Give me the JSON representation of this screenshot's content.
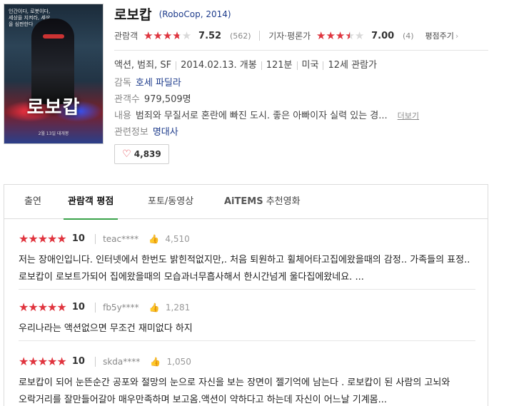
{
  "movie": {
    "poster_title": "로보캅",
    "poster_tagline": "인간이다, 로봇이다, 세상을 지켜라, 세상을 심판한다",
    "poster_release": "2월 13일 대개봉",
    "title_ko": "로보캅",
    "title_en": "(RoboCop, 2014)",
    "audience_label": "관람객",
    "audience_stars_fraction": 0.75,
    "audience_score": "7.52",
    "audience_count": "(562)",
    "critic_label": "기자·평론가",
    "critic_stars_fraction": 0.7,
    "critic_score": "7.00",
    "critic_count": "(4)",
    "rate_label": "평점주기",
    "genre": "액션, 범죄, SF",
    "release": "2014.02.13. 개봉",
    "runtime": "121분",
    "country": "미국",
    "age": "12세 관람가",
    "director_label": "감독",
    "director": "호세 파딜라",
    "audience_total_label": "관객수",
    "audience_total": "979,509명",
    "plot_label": "내용",
    "plot": "범죄와 무질서로 혼란에 빠진 도시. 좋은 아빠이자 실력 있는 경...",
    "more_label": "더보기",
    "related_label": "관련정보",
    "related_link": "명대사",
    "likes": "4,839"
  },
  "tabs": [
    {
      "label": "출연"
    },
    {
      "label": "관람객 평점"
    },
    {
      "label": "포토/동영상"
    },
    {
      "label": "AiTEMS"
    },
    {
      "label": "추천영화"
    }
  ],
  "reviews": [
    {
      "score": "10",
      "user": "teac****",
      "likes": "4,510",
      "text": "저는 장애인입니다. 인터넷에서 한번도 밝힌적없지만,. 처음 퇴원하고 휠체어타고집에왔을때의 감정.. 가족들의 표정.. 로보캅이 로보트가되어 집에왔을때의 모습과너무흡사해서 한시간넘게 울다집에왔네요. ..."
    },
    {
      "score": "10",
      "user": "fb5y****",
      "likes": "1,281",
      "text": "우리나라는 액션없으면 무조건 재미없다 하지"
    },
    {
      "score": "10",
      "user": "skda****",
      "likes": "1,050",
      "text": "로보캅이 되어 눈뜬순간 공포와 절망의 눈으로 자신을 보는 장면이 젤기억에 남는다 . 로보캅이 된 사람의 고뇌와 오락거리를 잘만들어갈아 매우만족하며 보고옴.액션이 약하다고 하는데 자신이 어느날 기계몸..."
    }
  ],
  "colors": {
    "star_red": "#e0343e",
    "link_blue": "#1e3c8c",
    "tab_green": "#3aa34a"
  }
}
